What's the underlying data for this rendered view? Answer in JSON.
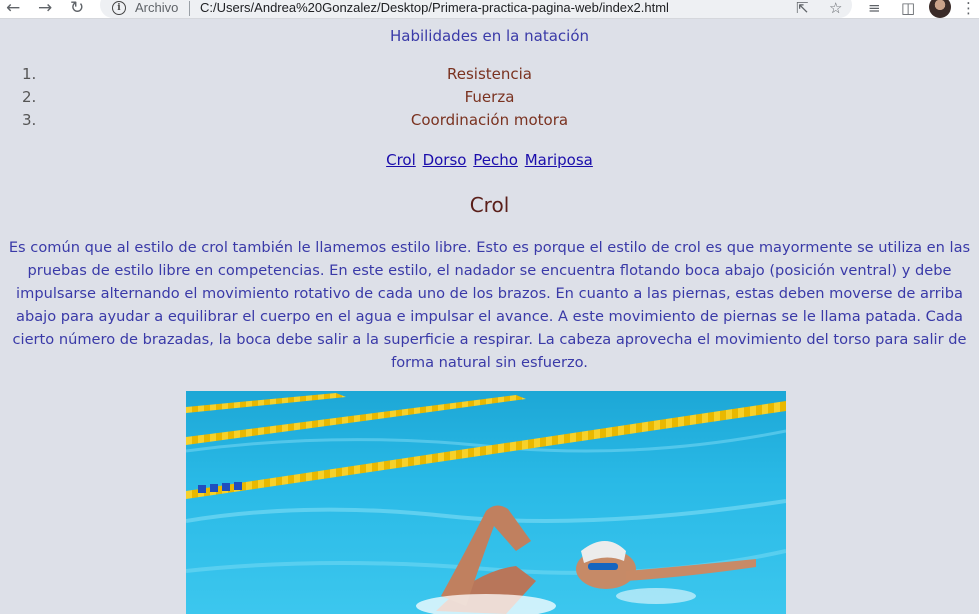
{
  "browser": {
    "scheme_label": "Archivo",
    "url": "C:/Users/Andrea%20Gonzalez/Desktop/Primera-practica-pagina-web/index2.html"
  },
  "page": {
    "heading": "Habilidades en la natación",
    "skills": [
      {
        "num": "1.",
        "label": "Resistencia"
      },
      {
        "num": "2.",
        "label": "Fuerza"
      },
      {
        "num": "3.",
        "label": "Coordinación motora"
      }
    ],
    "nav_links": [
      "Crol",
      "Dorso",
      "Pecho",
      "Mariposa"
    ],
    "section_title": "Crol",
    "paragraph": "Es común que al estilo de crol también le llamemos estilo libre. Esto es porque el estilo de crol es que mayormente se utiliza en las pruebas de estilo libre en competencias. En este estilo, el nadador se encuentra flotando boca abajo (posición ventral) y debe impulsarse alternando el movimiento rotativo de cada uno de los brazos. En cuanto a las piernas, estas deben moverse de arriba abajo para ayudar a equilibrar el cuerpo en el agua e impulsar el avance. A este movimiento de piernas se le llama patada. Cada cierto número de brazadas, la boca debe salir a la superficie a respirar. La cabeza aprovecha el movimiento del torso para salir de forma natural sin esfuerzo."
  }
}
